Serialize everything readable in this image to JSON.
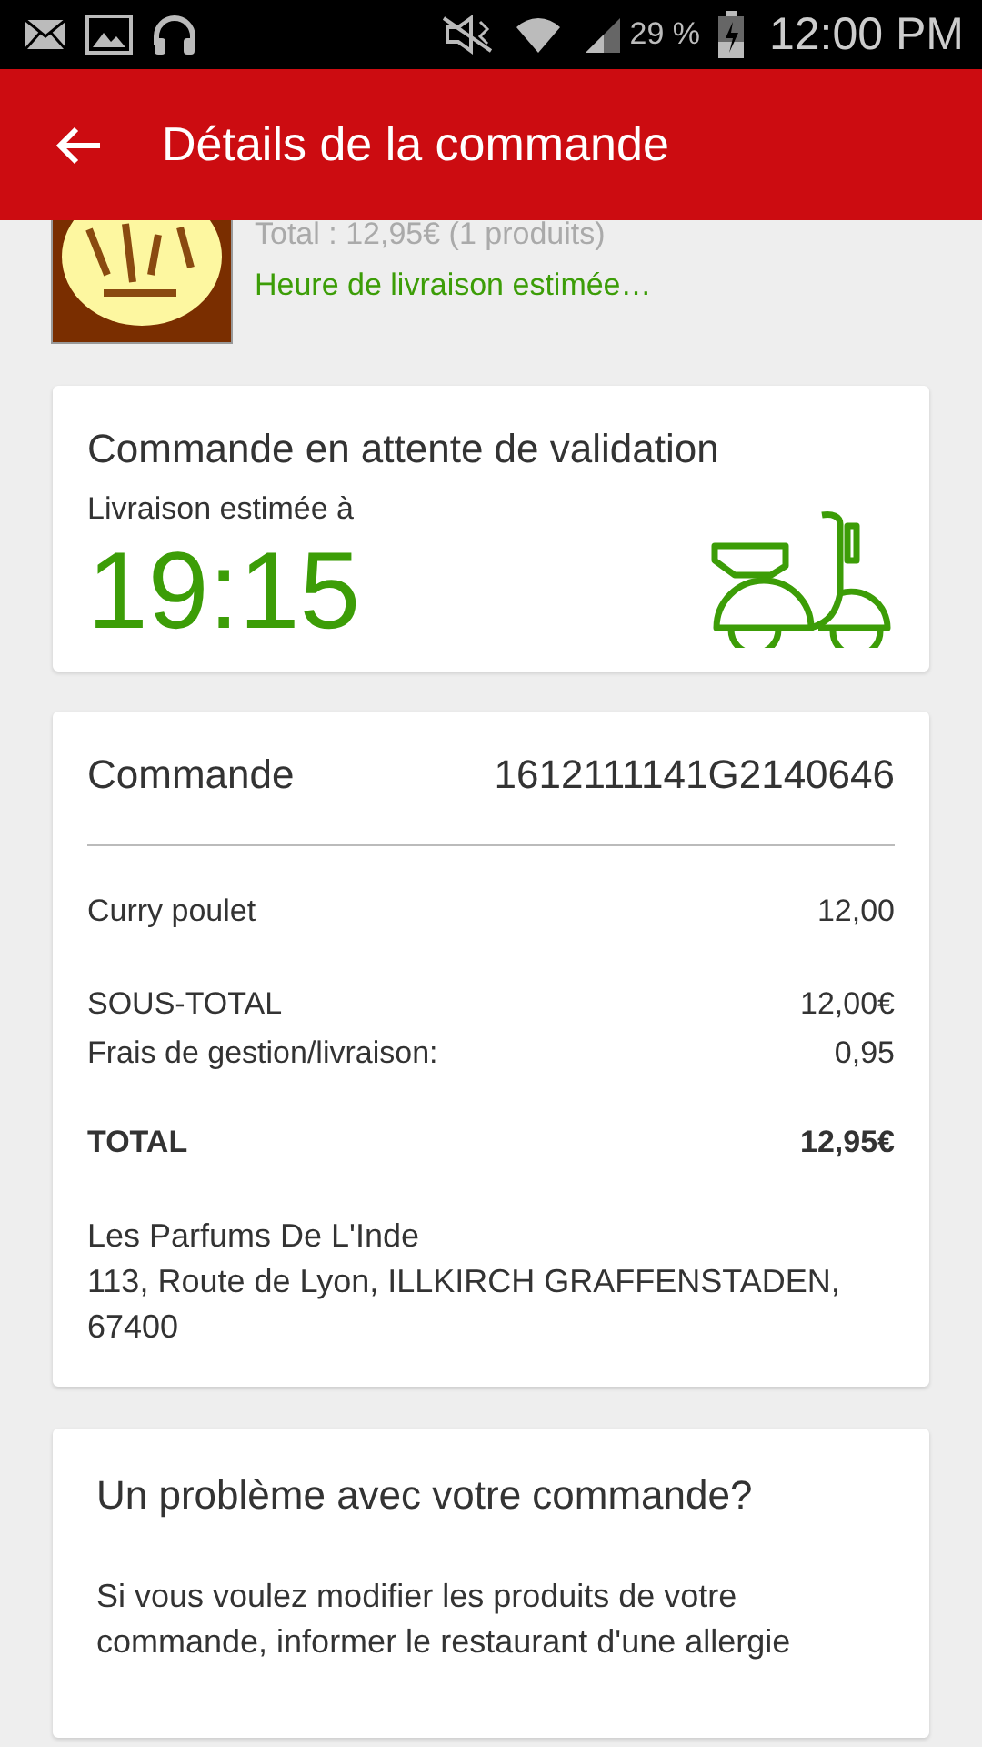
{
  "status_bar": {
    "battery_text": "29 %",
    "time": "12:00 PM"
  },
  "app_bar": {
    "title": "Détails de la commande"
  },
  "restaurant_header": {
    "total": "Total : 12,95€ (1 produits)",
    "delivery_hint": "Heure de livraison estimée…"
  },
  "status_card": {
    "title": "Commande en attente de validation",
    "subtitle": "Livraison estimée à",
    "time": "19:15"
  },
  "order_card": {
    "label": "Commande",
    "number": "1612111141G2140646",
    "lines": [
      {
        "kind": "item",
        "label": "Curry poulet",
        "value": "12,00"
      },
      {
        "kind": "subtotal",
        "label": "SOUS-TOTAL",
        "value": "12,00€"
      },
      {
        "kind": "fee",
        "label": "Frais de gestion/livraison:",
        "value": "0,95"
      },
      {
        "kind": "total",
        "label": "TOTAL",
        "value": "12,95€"
      }
    ],
    "restaurant_name": "Les Parfums De L'Inde",
    "address": "113, Route de Lyon, ILLKIRCH GRAFFENSTADEN, 67400"
  },
  "help_card": {
    "title": "Un problème avec votre commande?",
    "text": "Si vous voulez modifier les produits de votre commande, informer le restaurant d'une allergie"
  }
}
